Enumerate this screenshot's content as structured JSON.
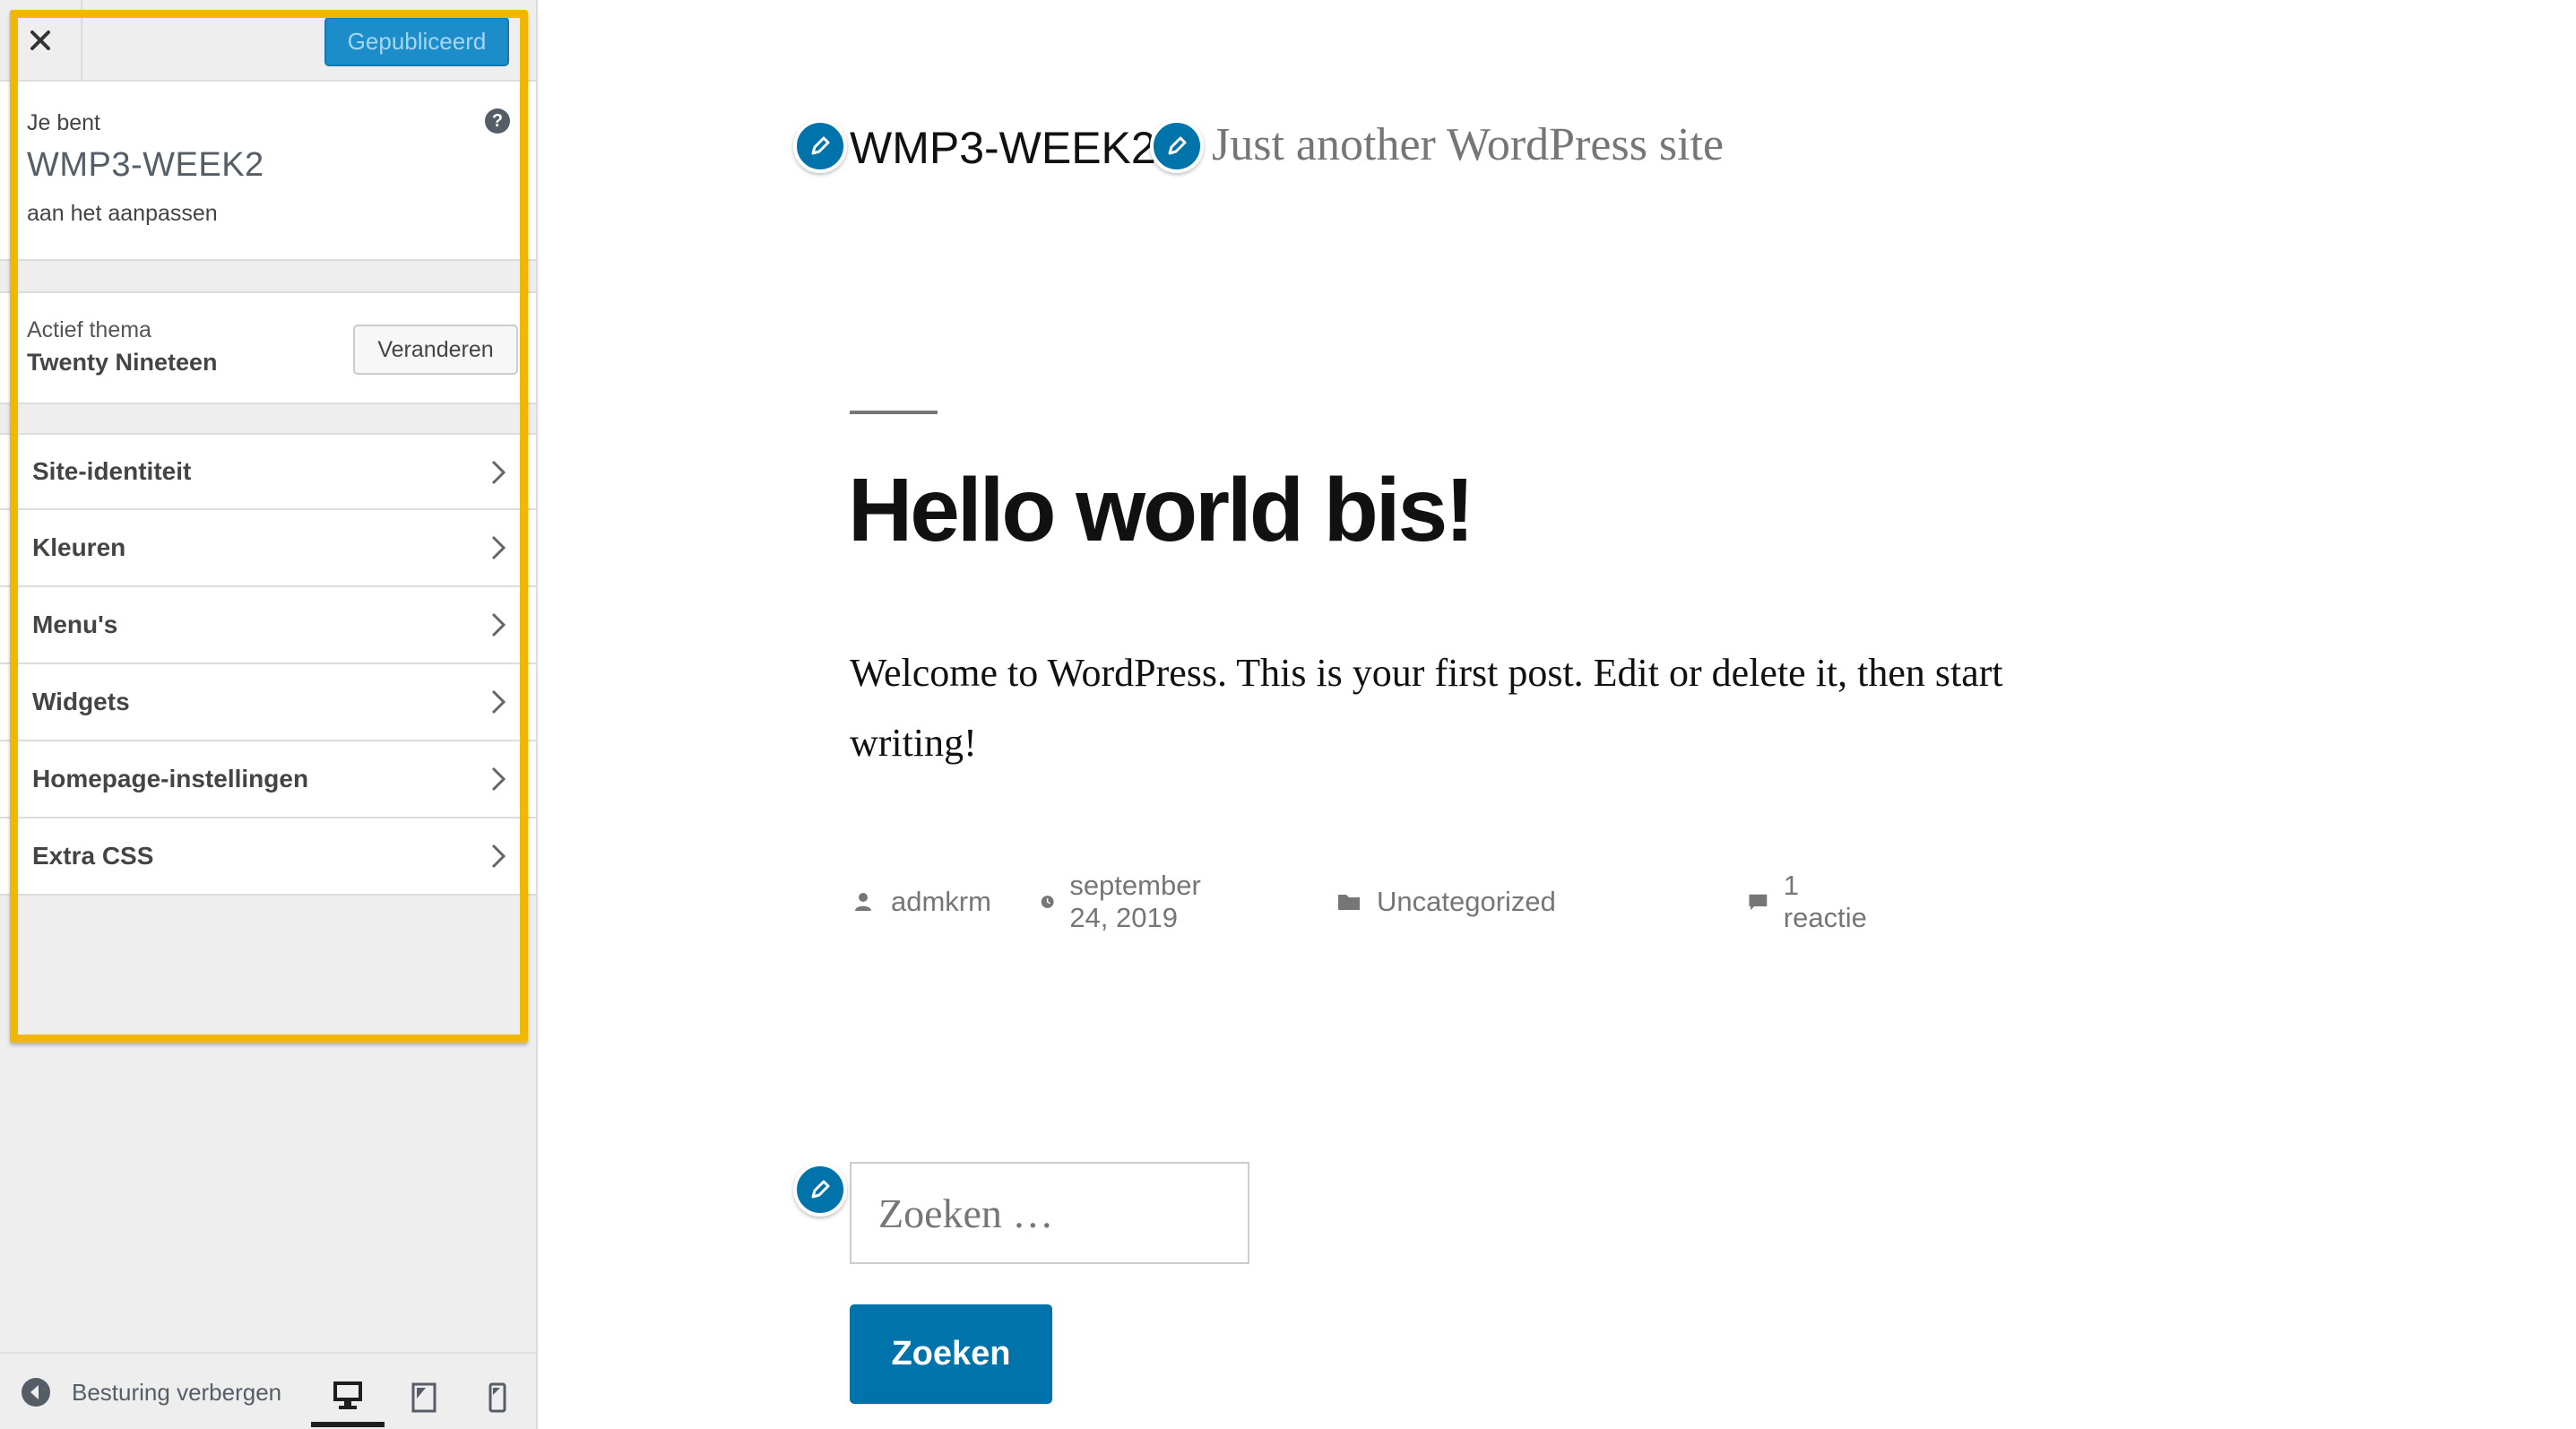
{
  "customizer": {
    "close_label": "Close",
    "publish_button": "Gepubliceerd",
    "info": {
      "prefix": "Je bent",
      "site_name": "WMP3-WEEK2",
      "suffix": "aan het aanpassen",
      "help_symbol": "?"
    },
    "theme": {
      "label": "Actief thema",
      "name": "Twenty Nineteen",
      "change_button": "Veranderen"
    },
    "sections": [
      {
        "label": "Site-identiteit"
      },
      {
        "label": "Kleuren"
      },
      {
        "label": "Menu's"
      },
      {
        "label": "Widgets"
      },
      {
        "label": "Homepage-instellingen"
      },
      {
        "label": "Extra CSS"
      }
    ],
    "footer": {
      "collapse_label": "Besturing verbergen",
      "active_device": "desktop",
      "devices": [
        "desktop",
        "tablet",
        "mobile"
      ]
    },
    "highlight_color": "#f2b704"
  },
  "preview": {
    "site_title": "WMP3-WEEK2",
    "tagline": "Just another WordPress site",
    "post": {
      "title": "Hello world bis!",
      "body": "Welcome to WordPress. This is your first post. Edit or delete it, then start writing!",
      "author": "admkrm",
      "date": "september 24, 2019",
      "category": "Uncategorized",
      "comments": "1 reactie"
    },
    "search": {
      "placeholder": "Zoeken …",
      "button": "Zoeken"
    },
    "accent_color": "#0073aa"
  }
}
